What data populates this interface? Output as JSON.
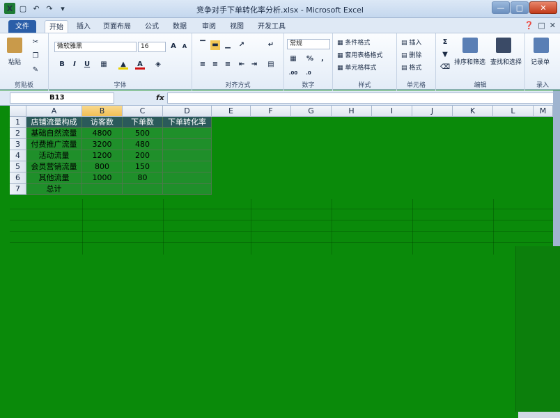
{
  "window": {
    "title": "竞争对手下单转化率分析.xlsx - Microsoft Excel",
    "app_logo": "X"
  },
  "tabs": [
    "文件",
    "开始",
    "插入",
    "页面布局",
    "公式",
    "数据",
    "审阅",
    "视图",
    "开发工具"
  ],
  "ribbon": {
    "clipboard": {
      "paste": "粘贴",
      "label": "剪贴板"
    },
    "font": {
      "name": "微软雅黑",
      "size": "16",
      "bold": "B",
      "italic": "I",
      "underline": "U",
      "label": "字体"
    },
    "alignment": {
      "label": "对齐方式"
    },
    "number": {
      "format": "常规",
      "percent": "%",
      "comma": ",",
      "label": "数字"
    },
    "styles": {
      "cond": "条件格式",
      "table": "套用表格格式",
      "cell": "单元格样式",
      "label": "样式"
    },
    "cells": {
      "insert": "插入",
      "delete": "删除",
      "format": "格式",
      "label": "单元格"
    },
    "editing": {
      "sort": "排序和筛选",
      "find": "查找和选择",
      "label": "编辑"
    },
    "record": {
      "button": "记录单",
      "label": "录入"
    }
  },
  "formula_bar": {
    "name_box": "B13",
    "fx": "fx",
    "content": ""
  },
  "sheet": {
    "columns": [
      "A",
      "B",
      "C",
      "D",
      "E",
      "F",
      "G",
      "H",
      "I",
      "J",
      "K",
      "L",
      "M"
    ],
    "rows": [
      "1",
      "2",
      "3",
      "4",
      "5",
      "6",
      "7"
    ],
    "data": [
      [
        "店铺流量构成",
        "访客数",
        "下单数",
        "下单转化率"
      ],
      [
        "基础自然流量",
        "4800",
        "500",
        ""
      ],
      [
        "付费推广流量",
        "3200",
        "480",
        ""
      ],
      [
        "活动流量",
        "1200",
        "200",
        ""
      ],
      [
        "会员营销流量",
        "800",
        "150",
        ""
      ],
      [
        "其他流量",
        "1000",
        "80",
        ""
      ],
      [
        "总计",
        "",
        "",
        ""
      ]
    ]
  },
  "colors": {
    "accent": "#2a5ea8",
    "sheet_bg": "#0a8a0a",
    "header_fill": "#2b5a5a",
    "selected_col": "#f1bf55"
  }
}
